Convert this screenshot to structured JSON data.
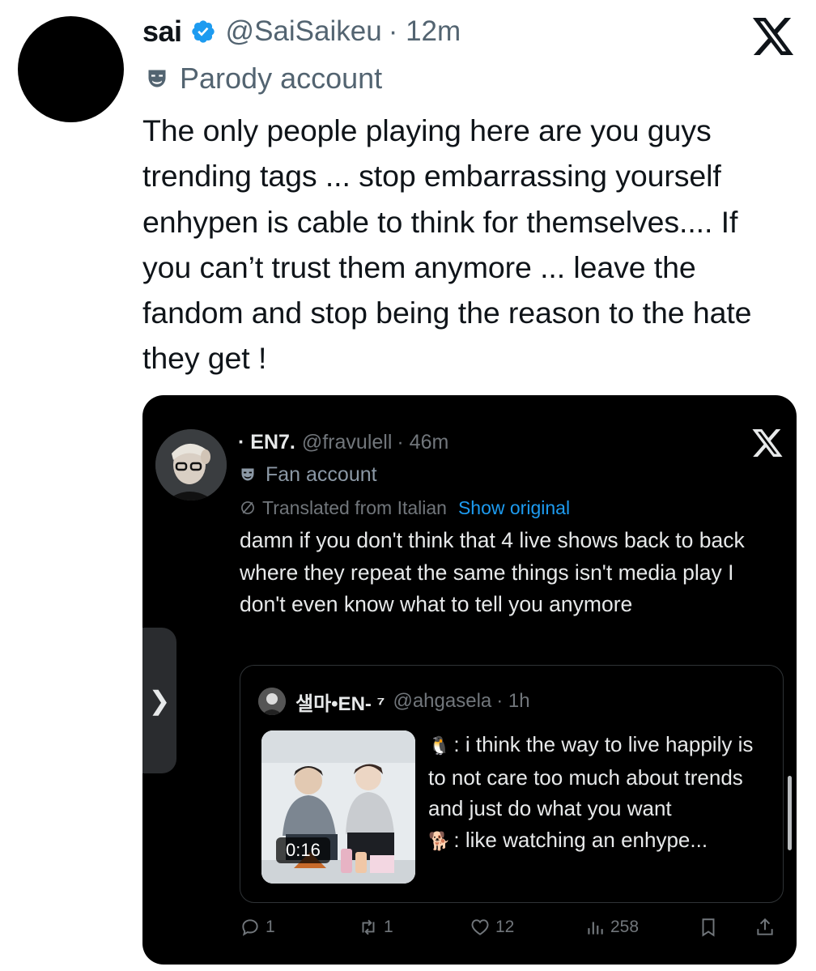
{
  "tweet": {
    "name": "sai",
    "handle": "@SaiSaikeu",
    "time": "· 12m",
    "label": "Parody account",
    "text": "The only people playing here are you guys trending tags ... stop embarrassing yourself enhypen is cable to think for themselves.... If you can’t trust them anymore ... leave the fandom and stop being the reason to the hate they get !"
  },
  "quoted": {
    "name": "· EN7.",
    "handle": "@fravulell",
    "time": "· 46m",
    "label": "Fan account",
    "translated": "Translated from Italian",
    "show_original": "Show original",
    "text": "damn if you don't think that 4 live shows back to back where they repeat the same things isn't media play I don't even know what to tell you anymore"
  },
  "nested": {
    "name": "샐마•EN- ⁷",
    "handle": "@ahgasela",
    "time": "· 1h",
    "duration": "0:16",
    "line1": ": i think the way to live happily is to not care too much about trends and just do what you want",
    "line2": ": like watching an enhype..."
  },
  "actions": {
    "replies": "1",
    "reposts": "1",
    "likes": "12",
    "views": "258"
  },
  "side_handle": "❯",
  "icons": [
    "verified-icon",
    "x-logo-icon",
    "parody-mask-icon",
    "translate-icon",
    "reply-icon",
    "repost-icon",
    "like-icon",
    "views-icon",
    "bookmark-icon",
    "share-icon",
    "chevron-right-icon"
  ],
  "colors": {
    "verified": "#1d9bf0",
    "link": "#1d9bf0",
    "card_bg": "#000000",
    "muted": "#536471"
  }
}
